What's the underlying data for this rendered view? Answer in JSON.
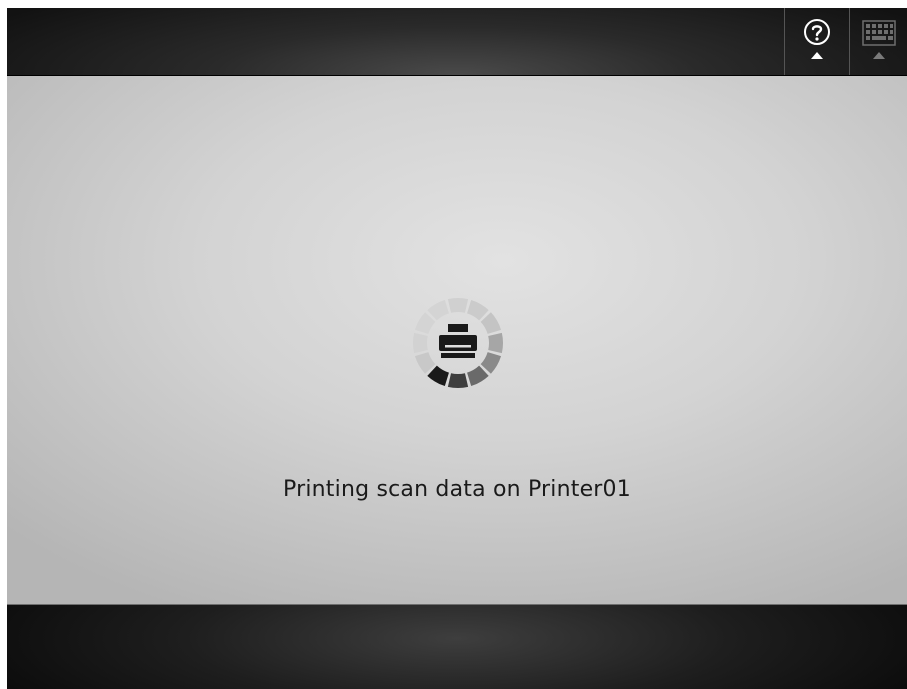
{
  "topbar": {
    "help_icon": "help-question-icon",
    "keyboard_icon": "keyboard-icon"
  },
  "main": {
    "status_text": "Printing scan data on Printer01",
    "spinner_icon": "printer-icon"
  },
  "colors": {
    "topbar": "#1a1a1a",
    "panel": "#d6d6d6",
    "spinner_active": "#1a1a1a",
    "spinner_inactive": "#c9c9c9"
  }
}
